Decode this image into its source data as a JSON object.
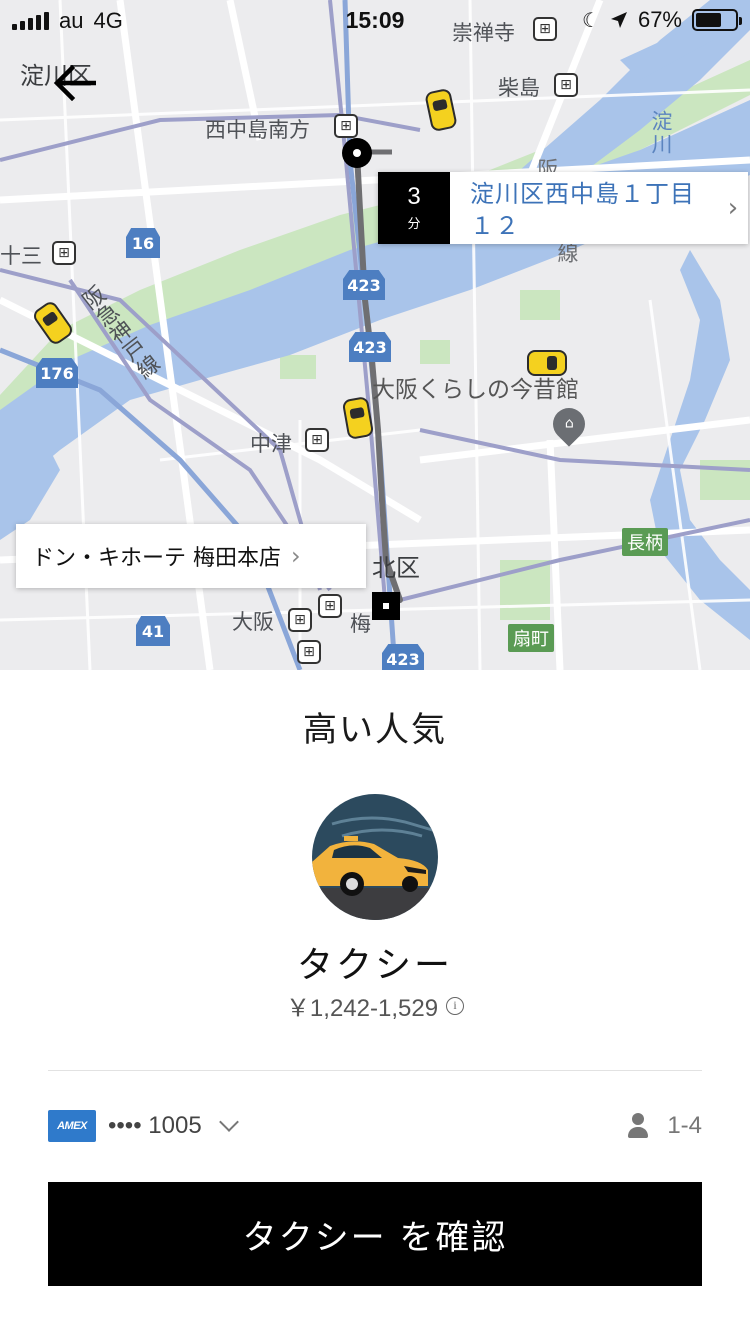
{
  "status_bar": {
    "carrier": "au",
    "network": "4G",
    "time": "15:09",
    "battery": "67%",
    "battery_level": 0.67
  },
  "map": {
    "labels": {
      "yodogawa_ward": "淀川区",
      "nishinakajima_minamigata": "西中島南方",
      "sujinji": "崇禅寺",
      "shibajima": "柴島",
      "juso": "十三",
      "hankyu_kobe_line": "阪急神戸線",
      "osaka_kurashi": "大阪くらしの今昔館",
      "nakatsu": "中津",
      "kita_ward": "北区",
      "osaka": "大阪",
      "umeda": "梅",
      "nagara": "長柄",
      "ogimachi": "扇町",
      "yodo_river_vertical": "淀川",
      "rail_vertical_left": "阪",
      "rail_vertical_right": "線"
    },
    "route_shields": [
      "16",
      "423",
      "423",
      "176",
      "41",
      "423"
    ],
    "eta": {
      "value": "3",
      "unit": "分"
    },
    "pickup_address_line1": "淀川区西中島１丁目",
    "pickup_address_line2": "１２",
    "destination": "ドン・キホーテ 梅田本店"
  },
  "sheet": {
    "title": "高い人気",
    "vehicle_name": "タクシー",
    "price": "￥1,242-1,529",
    "payment": {
      "brand": "AMEX",
      "card_number": "•••• 1005"
    },
    "seats": "1-4",
    "confirm_label": "タクシー を確認"
  },
  "colors": {
    "water": "#a9c4ea",
    "park": "#cbe6c0",
    "route": "#6f6f72",
    "taxi": "#f4d11f",
    "link": "#3d73b8",
    "confirm_bg": "#000000"
  }
}
